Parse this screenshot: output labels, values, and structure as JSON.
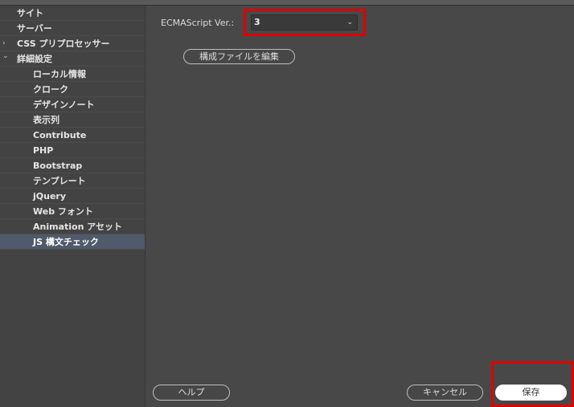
{
  "sidebar": {
    "items": [
      {
        "label": "サイト",
        "level": 0,
        "chevron": ""
      },
      {
        "label": "サーバー",
        "level": 0,
        "chevron": ""
      },
      {
        "label": "CSS プリプロセッサー",
        "level": 0,
        "chevron": "›"
      },
      {
        "label": "詳細設定",
        "level": 0,
        "chevron": "⌄"
      },
      {
        "label": "ローカル情報",
        "level": 1,
        "chevron": ""
      },
      {
        "label": "クローク",
        "level": 1,
        "chevron": ""
      },
      {
        "label": "デザインノート",
        "level": 1,
        "chevron": ""
      },
      {
        "label": "表示列",
        "level": 1,
        "chevron": ""
      },
      {
        "label": "Contribute",
        "level": 1,
        "chevron": ""
      },
      {
        "label": "PHP",
        "level": 1,
        "chevron": ""
      },
      {
        "label": "Bootstrap",
        "level": 1,
        "chevron": ""
      },
      {
        "label": "テンプレート",
        "level": 1,
        "chevron": ""
      },
      {
        "label": "jQuery",
        "level": 1,
        "chevron": ""
      },
      {
        "label": "Web フォント",
        "level": 1,
        "chevron": ""
      },
      {
        "label": "Animation アセット",
        "level": 1,
        "chevron": ""
      },
      {
        "label": "JS 構文チェック",
        "level": 1,
        "chevron": "",
        "selected": true
      }
    ]
  },
  "main": {
    "ecma_label": "ECMAScript Ver.:",
    "ecma_value": "3",
    "ecma_arrow": "⌄",
    "edit_config_button": "構成ファイルを編集"
  },
  "footer": {
    "help_button": "ヘルプ",
    "cancel_button": "キャンセル",
    "save_button": "保存"
  },
  "colors": {
    "highlight": "#e00000",
    "selected_row": "#4f5a6b"
  }
}
